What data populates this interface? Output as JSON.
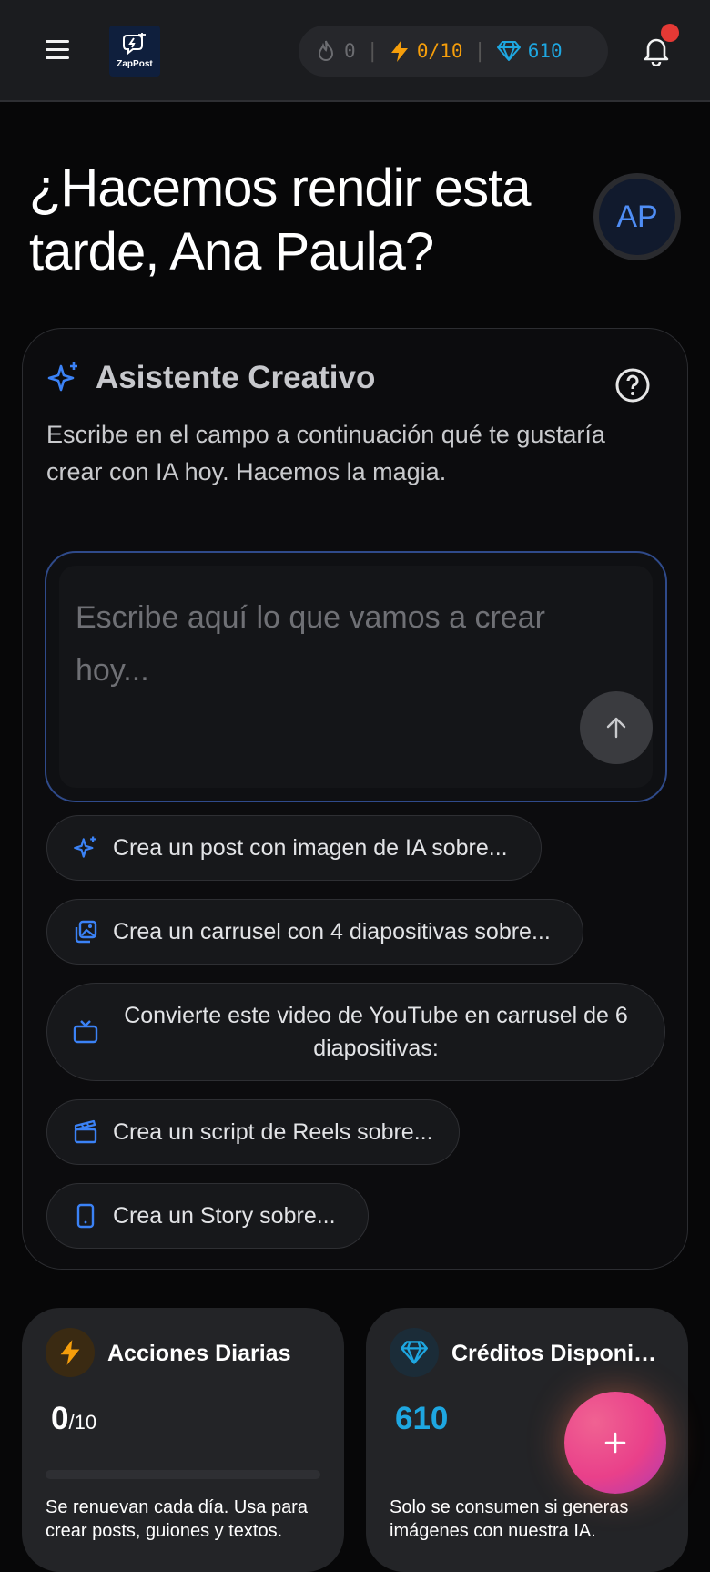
{
  "header": {
    "logo_text": "ZapPost",
    "streak_count": "0",
    "daily_actions": "0/10",
    "credits": "610",
    "menu_icon": "hamburger-menu-icon",
    "bell_icon": "bell-icon"
  },
  "greeting": {
    "text": "¿Hacemos rendir esta tarde, Ana Paula?",
    "avatar_initials": "AP"
  },
  "assistant": {
    "title": "Asistente Creativo",
    "description": "Escribe en el campo a continuación qué te gustaría crear con IA hoy. Hacemos la magia.",
    "placeholder": "Escribe aquí lo que vamos a crear hoy...",
    "suggestions": [
      {
        "label": "Crea un post con imagen de IA sobre...",
        "icon": "sparkles-icon"
      },
      {
        "label": "Crea un carrusel con 4 diapositivas sobre...",
        "icon": "images-icon"
      },
      {
        "label": "Convierte este video de YouTube en carrusel de 6 diapositivas:",
        "icon": "tv-icon"
      },
      {
        "label": "Crea un script de Reels sobre...",
        "icon": "clapperboard-icon"
      },
      {
        "label": "Crea un Story sobre...",
        "icon": "smartphone-icon"
      }
    ]
  },
  "cards": {
    "daily": {
      "title": "Acciones Diarias",
      "value": "0",
      "unit": "/10",
      "progress": 0,
      "description": "Se renuevan cada día. Usa para crear posts, guiones y textos."
    },
    "credits": {
      "title": "Créditos Disponibles",
      "value": "610",
      "description": "Solo se consumen si generas imágenes con nuestra IA."
    }
  },
  "colors": {
    "accent_blue": "#3b82f6",
    "diamond_blue": "#1ea7e1",
    "bolt_orange": "#f59e0b",
    "notification_red": "#e53935",
    "fab_pink": "#e9408a"
  }
}
